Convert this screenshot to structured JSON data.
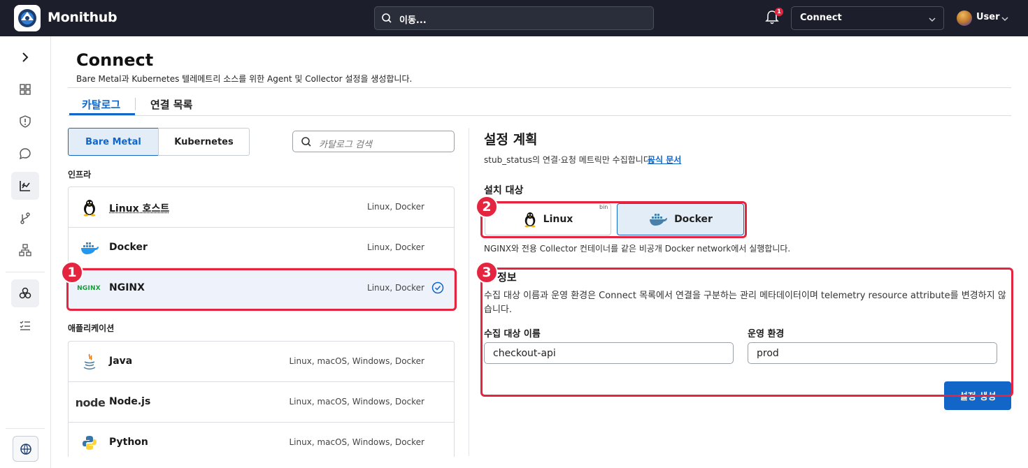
{
  "topbar": {
    "brand": "Monithub",
    "search_placeholder": "이동...",
    "notification_count": "1",
    "connect_select": "Connect",
    "user_name": "User"
  },
  "sidebar": {
    "items": [
      "expand",
      "dashboard",
      "security",
      "chat",
      "charts",
      "git",
      "hierarchy",
      "integrations",
      "checklist"
    ],
    "active": "charts"
  },
  "header": {
    "title": "Connect",
    "subtitle": "Bare Metal과 Kubernetes 텔레메트리 소스를 위한 Agent 및 Collector 설정을 생성합니다."
  },
  "tabs": [
    {
      "label": "카탈로그",
      "active": true
    },
    {
      "label": "연결 목록",
      "active": false
    }
  ],
  "catalog": {
    "segments": [
      {
        "label": "Bare Metal",
        "active": true
      },
      {
        "label": "Kubernetes",
        "active": false
      }
    ],
    "search_placeholder": "카탈로그 검색",
    "sections": [
      {
        "label": "인프라",
        "items": [
          {
            "name": "Linux 호스트",
            "platforms": "Linux, Docker",
            "icon": "tux-icon",
            "selected": false
          },
          {
            "name": "Docker",
            "platforms": "Linux, Docker",
            "icon": "docker-icon",
            "selected": false
          },
          {
            "name": "NGINX",
            "platforms": "Linux, Docker",
            "icon": "nginx-icon",
            "icon_text": "NGINX",
            "selected": true
          }
        ]
      },
      {
        "label": "애플리케이션",
        "items": [
          {
            "name": "Java",
            "platforms": "Linux, macOS, Windows, Docker",
            "icon": "java-icon"
          },
          {
            "name": "Node.js",
            "platforms": "Linux, macOS, Windows, Docker",
            "icon": "nodejs-icon",
            "icon_text": "node"
          },
          {
            "name": "Python",
            "platforms": "Linux, macOS, Windows, Docker",
            "icon": "python-icon"
          }
        ]
      }
    ]
  },
  "plan": {
    "title": "설정 계획",
    "description": "stub_status의 연결·요청 메트릭만 수집합니다.",
    "doc_link": "공식 문서",
    "install_target_label": "설치 대상",
    "targets": [
      {
        "label": "Linux",
        "tag": "bin",
        "selected": false
      },
      {
        "label": "Docker",
        "selected": true
      }
    ],
    "target_note": "NGINX와 전용 Collector 컨테이너를 같은 비공개 Docker network에서 실행합니다.",
    "connection_info_title": "결 정보",
    "connection_info_desc": "수집 대상 이름과 운영 환경은 Connect 목록에서 연결을 구분하는 관리 메타데이터이며 telemetry resource attribute를 변경하지 않습니다.",
    "fields": [
      {
        "label": "수집 대상 이름",
        "value": "checkout-api"
      },
      {
        "label": "운영 환경",
        "value": "prod"
      }
    ],
    "generate_button": "설정 생성"
  },
  "annotations": [
    "1",
    "2",
    "3"
  ],
  "colors": {
    "accent": "#1166c8",
    "topbar_bg": "#1c1f2b",
    "annotation": "#e5243f",
    "selected_bg": "#e3edf8"
  }
}
